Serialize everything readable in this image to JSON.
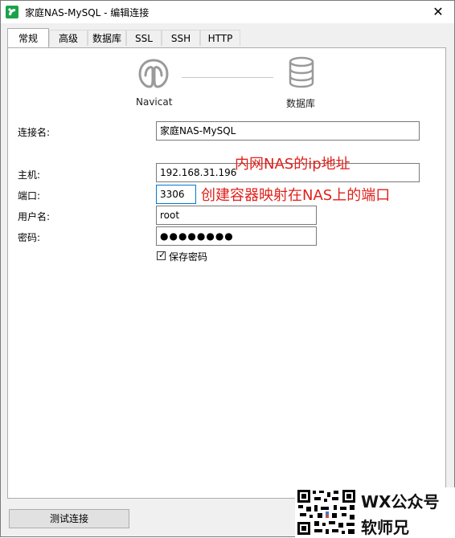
{
  "window": {
    "title": "家庭NAS-MySQL - 编辑连接",
    "close_glyph": "✕"
  },
  "tabs": [
    {
      "label": "常规",
      "active": true
    },
    {
      "label": "高级",
      "active": false
    },
    {
      "label": "数据库",
      "active": false
    },
    {
      "label": "SSL",
      "active": false
    },
    {
      "label": "SSH",
      "active": false
    },
    {
      "label": "HTTP",
      "active": false
    }
  ],
  "diagram": {
    "client_label": "Navicat",
    "server_label": "数据库",
    "client_icon": "navicat-logo-icon",
    "server_icon": "database-icon"
  },
  "form": {
    "connection_name_label": "连接名:",
    "connection_name_value": "家庭NAS-MySQL",
    "host_label": "主机:",
    "host_value": "192.168.31.196",
    "port_label": "端口:",
    "port_value": "3306",
    "username_label": "用户名:",
    "username_value": "root",
    "password_label": "密码:",
    "password_value": "●●●●●●●●",
    "save_password_label": "保存密码",
    "save_password_checked": true,
    "checkbox_glyph": "✓"
  },
  "annotations": {
    "host_note": "内网NAS的ip地址",
    "port_note": "创建容器映射在NAS上的端口"
  },
  "footer": {
    "test_connection_label": "测试连接"
  },
  "watermark": {
    "line1": "WX公众号",
    "line2": "软师兄"
  },
  "colors": {
    "annotation": "#e0201a",
    "focus_border": "#0078d7",
    "app_icon": "#1aa34a"
  }
}
